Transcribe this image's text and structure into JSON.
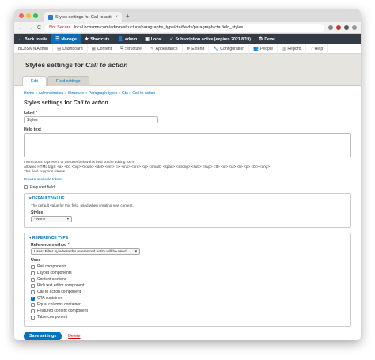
{
  "browser": {
    "tab_title": "Styles settings for Call to actio",
    "tab_close": "×",
    "new_tab": "+",
    "nav_back": "←",
    "nav_forward": "→",
    "nav_reload": "C",
    "security_label": "Not Secure",
    "url": "local.bcbsmn.com/admin/structure/paragraphs_type/cta/fields/paragraph.cta.field_styles"
  },
  "toolbar": {
    "items": [
      {
        "icon": "←",
        "label": "Back to site"
      },
      {
        "icon": "☰",
        "label": "Manage"
      },
      {
        "icon": "★",
        "label": "Shortcuts"
      },
      {
        "icon": "👤",
        "label": "admin"
      },
      {
        "icon": "▣",
        "label": "Local"
      },
      {
        "icon": "✔",
        "label": "Subscription active (expires 2021/8/19)"
      },
      {
        "icon": "⚙",
        "label": "Devel"
      }
    ]
  },
  "admin_menu": {
    "items": [
      {
        "icon": "",
        "label": "BCBSMN Admin"
      },
      {
        "icon": "▤",
        "label": "Dashboard"
      },
      {
        "icon": "▦",
        "label": "Content"
      },
      {
        "icon": "⧉",
        "label": "Structure"
      },
      {
        "icon": "✎",
        "label": "Appearance"
      },
      {
        "icon": "✚",
        "label": "Extend"
      },
      {
        "icon": "🔧",
        "label": "Configuration"
      },
      {
        "icon": "👥",
        "label": "People"
      },
      {
        "icon": "▥",
        "label": "Reports"
      },
      {
        "icon": "?",
        "label": "Help"
      }
    ]
  },
  "header": {
    "title_prefix": "Styles settings for ",
    "title_em": "Call to action",
    "tabs": [
      {
        "label": "Edit"
      },
      {
        "label": "Field settings"
      }
    ]
  },
  "breadcrumb": "Home » Administration » Structure » Paragraph types » Cta » Call to action",
  "form": {
    "title_prefix": "Styles settings for ",
    "title_em": "Call to action",
    "label_label": "Label",
    "label_required": "*",
    "label_value": "Styles",
    "help_label": "Help text",
    "help_desc1": "Instructions to present to the user below this field on the editing form.",
    "help_desc2": "Allowed HTML tags: <a> <b> <big> <code> <del> <em> <i> <ins> <pre> <q> <small> <span> <strong> <sub> <sup> <tt> <ol> <ul> <li> <p> <br> <img>",
    "help_desc3": "This field supports tokens.",
    "browse_tokens": "Browse available tokens.",
    "required_label": "Required field",
    "default_value": {
      "legend": "▾ DEFAULT VALUE",
      "desc": "The default value for this field, used when creating new content.",
      "styles_label": "Styles",
      "styles_select": "- None -",
      "select_arrow": "▾"
    },
    "reference_type": {
      "legend": "▾ REFERENCE TYPE",
      "method_label": "Reference method",
      "method_required": "*",
      "method_select": "Uses: Filter by where the referenced entity will be used.",
      "select_arrow": "▾",
      "uses_label": "Uses",
      "uses": [
        {
          "label": "Rail components",
          "checked": false
        },
        {
          "label": "Layout components",
          "checked": false
        },
        {
          "label": "Content sections",
          "checked": false
        },
        {
          "label": "Rich text editor component",
          "checked": false
        },
        {
          "label": "Call to action component",
          "checked": false
        },
        {
          "label": "CTA container",
          "checked": true
        },
        {
          "label": "Equal columns container",
          "checked": false
        },
        {
          "label": "Featured content component",
          "checked": false
        },
        {
          "label": "Table component",
          "checked": false
        }
      ]
    },
    "save_label": "Save settings",
    "delete_label": "Delete"
  },
  "colors": {
    "toolbar_bg": "#353b44",
    "toolbar_active": "#0b6db7",
    "link": "#0074bd",
    "primary_button": "#0074bd",
    "danger": "#cc0000",
    "header_bg": "#e6e4df"
  }
}
